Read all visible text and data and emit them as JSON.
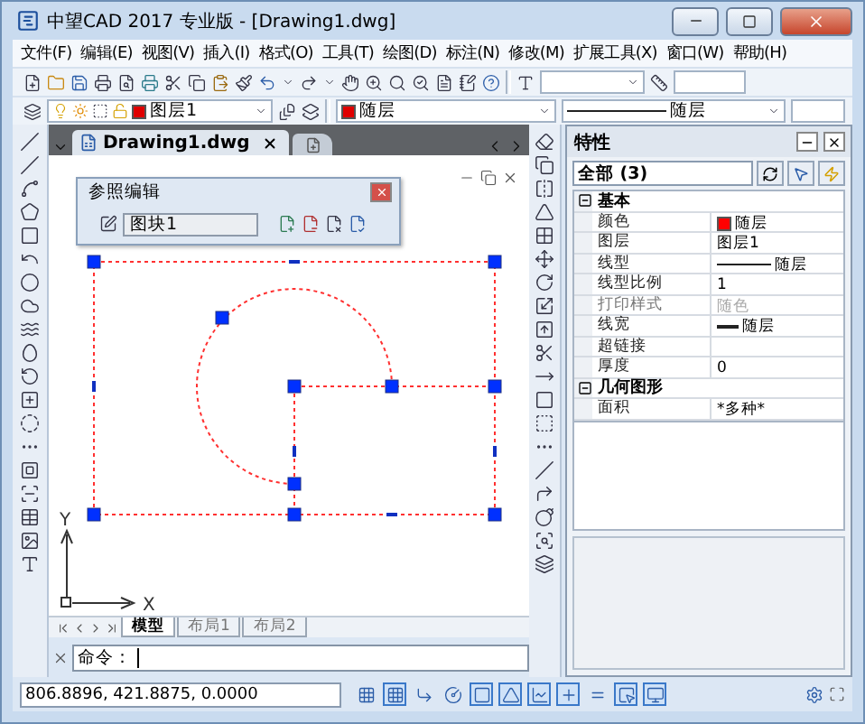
{
  "window": {
    "title": "中望CAD 2017 专业版 - [Drawing1.dwg]"
  },
  "menu": [
    "文件(F)",
    "编辑(E)",
    "视图(V)",
    "插入(I)",
    "格式(O)",
    "工具(T)",
    "绘图(D)",
    "标注(N)",
    "修改(M)",
    "扩展工具(X)",
    "窗口(W)",
    "帮助(H)"
  ],
  "layer_toolbar": {
    "layer": "图层1",
    "color_setting": "随层",
    "linetype_setting": "随层"
  },
  "document_tab": {
    "title": "Drawing1.dwg"
  },
  "ref_edit": {
    "title": "参照编辑",
    "block": "图块1"
  },
  "ucs": {
    "x": "X",
    "y": "Y"
  },
  "layout_tabs": [
    {
      "label": "模型",
      "selected": true
    },
    {
      "label": "布局1",
      "selected": false
    },
    {
      "label": "布局2",
      "selected": false
    }
  ],
  "command": {
    "prompt": "命令："
  },
  "properties": {
    "title": "特性",
    "selection": "全部 (3)",
    "groups": [
      {
        "label": "基本",
        "expanded": true,
        "rows": [
          {
            "name": "颜色",
            "kind": "color",
            "value": "随层",
            "color": "#ff0000",
            "disabled": false
          },
          {
            "name": "图层",
            "kind": "text",
            "value": "图层1",
            "disabled": false
          },
          {
            "name": "线型",
            "kind": "linetype",
            "value": "随层",
            "disabled": false
          },
          {
            "name": "线型比例",
            "kind": "text",
            "value": "1",
            "disabled": false
          },
          {
            "name": "打印样式",
            "kind": "text",
            "value": "随色",
            "disabled": true
          },
          {
            "name": "线宽",
            "kind": "lineweight",
            "value": "随层",
            "disabled": false
          },
          {
            "name": "超链接",
            "kind": "text",
            "disabled": false
          },
          {
            "name": "厚度",
            "kind": "text",
            "value": "0",
            "disabled": false
          }
        ]
      },
      {
        "label": "几何图形",
        "expanded": true,
        "rows": [
          {
            "name": "面积",
            "kind": "text",
            "value": "*多种*",
            "disabled": false
          }
        ]
      }
    ]
  },
  "status_bar": {
    "coordinates": "806.8896, 421.8875, 0.0000",
    "toggles": [
      {
        "on": false
      },
      {
        "on": true
      },
      {
        "on": false
      },
      {
        "on": false
      },
      {
        "on": true
      },
      {
        "on": true
      },
      {
        "on": true
      },
      {
        "on": true
      },
      {
        "on": false
      },
      {
        "on": true
      },
      {
        "on": true
      }
    ]
  }
}
